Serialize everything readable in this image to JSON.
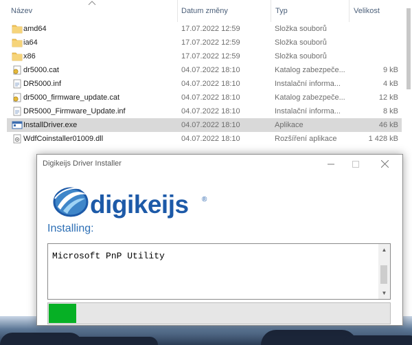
{
  "explorer": {
    "columns": {
      "name": "Název",
      "date": "Datum změny",
      "type": "Typ",
      "size": "Velikost"
    },
    "files": [
      {
        "name": "amd64",
        "date": "17.07.2022 12:59",
        "type": "Složka souborů",
        "size": "",
        "icon": "folder-icon"
      },
      {
        "name": "ia64",
        "date": "17.07.2022 12:59",
        "type": "Složka souborů",
        "size": "",
        "icon": "folder-icon"
      },
      {
        "name": "x86",
        "date": "17.07.2022 12:59",
        "type": "Složka souborů",
        "size": "",
        "icon": "folder-icon"
      },
      {
        "name": "dr5000.cat",
        "date": "04.07.2022 18:10",
        "type": "Katalog zabezpeče...",
        "size": "9 kB",
        "icon": "security-catalog-icon"
      },
      {
        "name": "DR5000.inf",
        "date": "04.07.2022 18:10",
        "type": "Instalační informa...",
        "size": "4 kB",
        "icon": "setup-info-icon"
      },
      {
        "name": "dr5000_firmware_update.cat",
        "date": "04.07.2022 18:10",
        "type": "Katalog zabezpeče...",
        "size": "12 kB",
        "icon": "security-catalog-icon"
      },
      {
        "name": "DR5000_Firmware_Update.inf",
        "date": "04.07.2022 18:10",
        "type": "Instalační informa...",
        "size": "8 kB",
        "icon": "setup-info-icon"
      },
      {
        "name": "InstallDriver.exe",
        "date": "04.07.2022 18:10",
        "type": "Aplikace",
        "size": "46 kB",
        "icon": "application-icon",
        "selected": true
      },
      {
        "name": "WdfCoinstaller01009.dll",
        "date": "04.07.2022 18:10",
        "type": "Rozšíření aplikace",
        "size": "1 428 kB",
        "icon": "dll-icon"
      }
    ]
  },
  "installer": {
    "title": "Digikeijs Driver Installer",
    "brand": "digikeijs",
    "brand_mark": "®",
    "status_label": "Installing:",
    "output_text": "Microsoft PnP Utility",
    "progress": 0.08
  },
  "colors": {
    "brand_blue": "#1d5aa8",
    "progress_green": "#06b025",
    "selection_gray": "#d9d9d9"
  }
}
